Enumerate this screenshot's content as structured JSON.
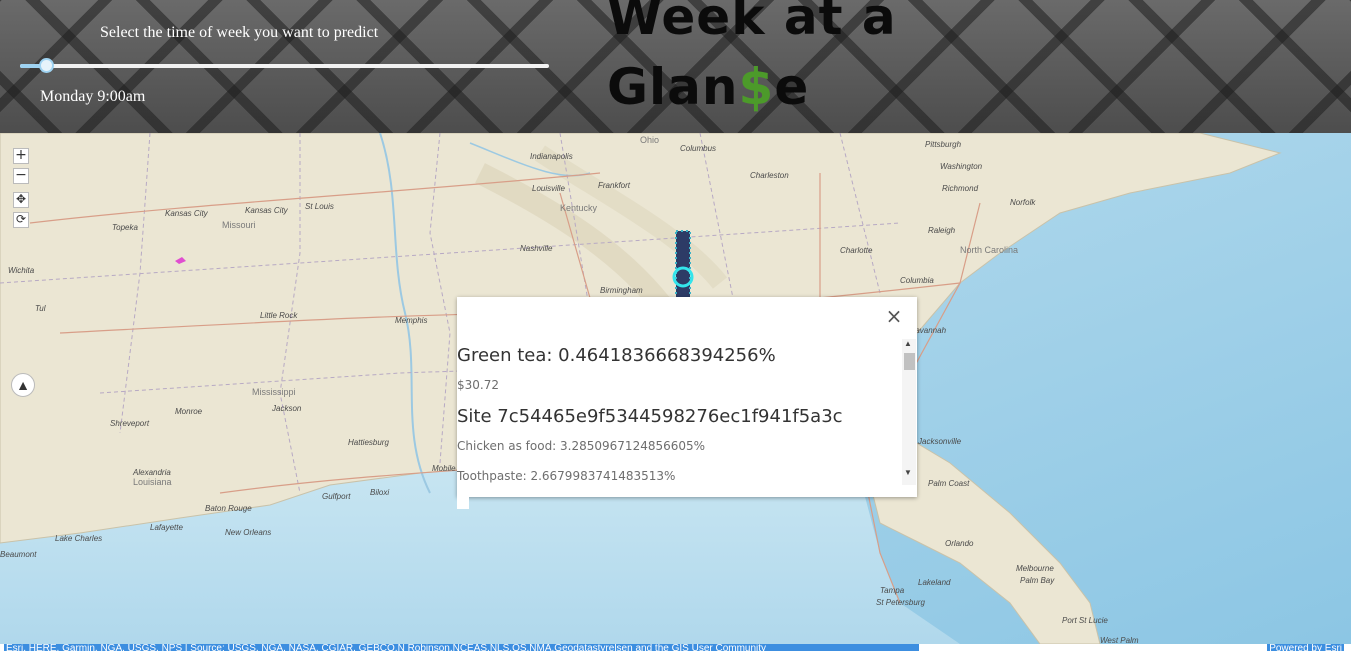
{
  "header": {
    "slider_title": "Select the time of week you want to predict",
    "slider_value_label": "Monday 9:00am",
    "slider_position": 0.05,
    "logo_line1": "Week at a",
    "logo_line2_prefix": "Glan",
    "logo_line2_dollar": "$",
    "logo_line2_suffix": "e"
  },
  "map": {
    "nav": {
      "zoom_in": "+",
      "zoom_out": "−",
      "pan": "✥",
      "rotate": "⟳",
      "compass": "▲"
    },
    "cities": [
      "Indianapolis",
      "Columbus",
      "Pittsburgh",
      "Louisville",
      "Frankfort",
      "Charleston",
      "Washington",
      "Richmond",
      "Norfolk",
      "Kansas City",
      "Kansas City",
      "St Louis",
      "Topeka",
      "Wichita",
      "Kentucky",
      "Raleigh",
      "North Carolina",
      "Nashville",
      "Birmingham",
      "Columbia",
      "Charlotte",
      "Tul",
      "Little Rock",
      "Memphis",
      "Mississippi",
      "Jackson",
      "Shreveport",
      "Monroe",
      "Alexandria",
      "Louisiana",
      "Baton Rouge",
      "Lafayette",
      "Lake Charles",
      "New Orleans",
      "Gulfport",
      "Biloxi",
      "Hattiesburg",
      "Mobile",
      "Savannah",
      "Jacksonville",
      "Palm Coast",
      "Orlando",
      "Melbourne",
      "Palm Bay",
      "Tampa",
      "Lakeland",
      "St Petersburg",
      "Port St Lucie",
      "West Palm",
      "Beaumont",
      "Missouri",
      "Ohio"
    ]
  },
  "popup": {
    "close": "×",
    "title": "Green tea: 0.4641836668394256%",
    "price": "$30.72",
    "site": "Site 7c54465e9f5344598276ec1f941f5a3c",
    "line1": "Chicken as food: 3.2850967124856605%",
    "line2": "Toothpaste: 2.6679983741483513%"
  },
  "attribution": {
    "text": "Esri, HERE, Garmin, NGA, USGS, NPS | Source: USGS, NGA, NASA, CGIAR, GEBCO,N Robinson,NCEAS,NLS,OS,NMA,Geodatastyrelsen and the GIS User Community",
    "powered": "Powered by Esri"
  },
  "colors": {
    "ocean": "#a8d3ea",
    "land": "#e9e4d3",
    "slider_accent": "#9fd3f2",
    "logo_dollar": "#4c9a2a",
    "attribution_bg": "#3c8ee0"
  }
}
